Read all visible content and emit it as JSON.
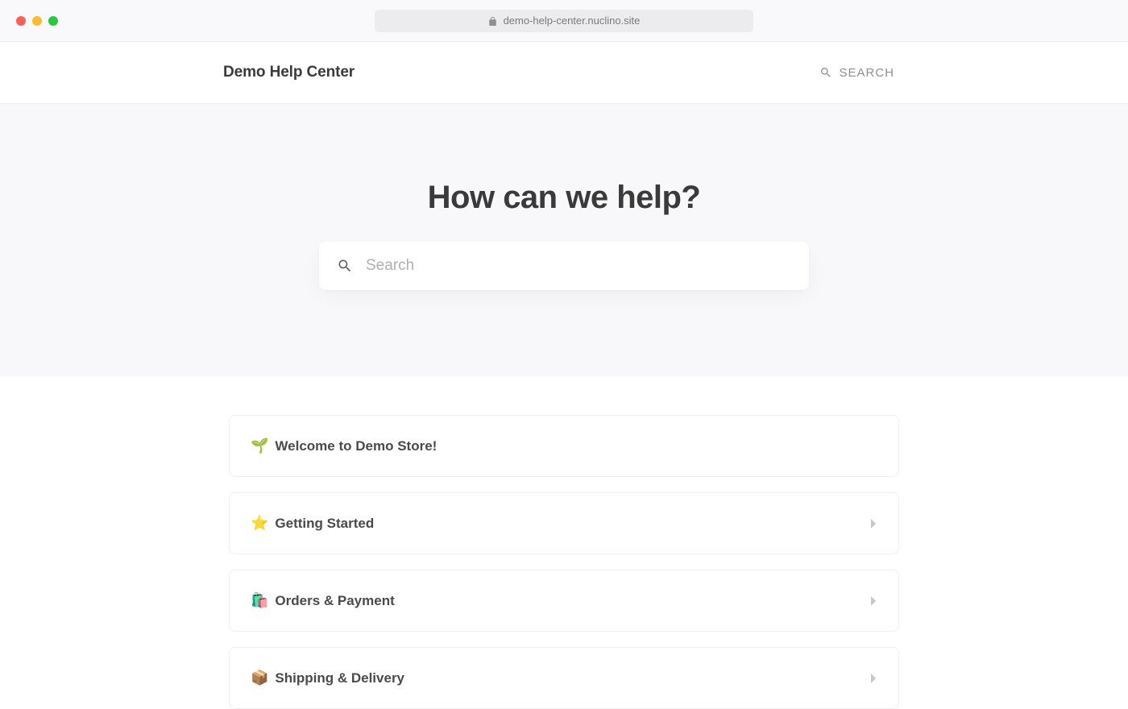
{
  "browser": {
    "url": "demo-help-center.nuclino.site"
  },
  "header": {
    "title": "Demo Help Center",
    "search_label": "SEARCH"
  },
  "hero": {
    "title": "How can we help?",
    "search_placeholder": "Search"
  },
  "cards": [
    {
      "emoji": "🌱",
      "title": "Welcome to Demo Store!",
      "chevron": false
    },
    {
      "emoji": "⭐",
      "title": "Getting Started",
      "chevron": true
    },
    {
      "emoji": "🛍️",
      "title": "Orders & Payment",
      "chevron": true
    },
    {
      "emoji": "📦",
      "title": "Shipping & Delivery",
      "chevron": true
    }
  ]
}
